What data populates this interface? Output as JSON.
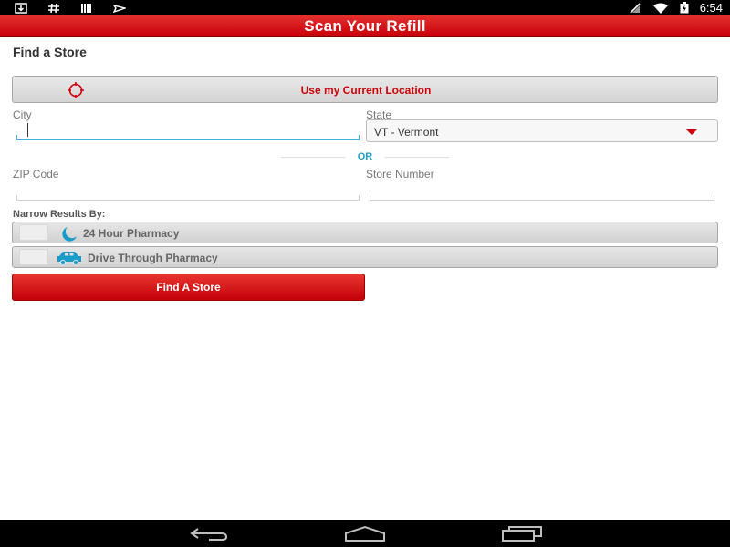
{
  "status_bar": {
    "left_icons": [
      "download-icon",
      "hash-icon",
      "bars-icon",
      "plane-icon"
    ],
    "right_icons": [
      "no-signal-icon",
      "wifi-icon",
      "battery-icon"
    ],
    "time": "6:54"
  },
  "app": {
    "title": "Scan Your Refill",
    "brand_color": "#d0000a"
  },
  "form": {
    "section_title": "Find a Store",
    "use_location_label": "Use my Current Location",
    "city_label": "City",
    "city_value": "",
    "state_label": "State",
    "state_value": "VT - Vermont",
    "or_label": "OR",
    "zip_label": "ZIP Code",
    "zip_value": "",
    "store_number_label": "Store Number",
    "store_number_value": "",
    "narrow_label": "Narrow Results By:",
    "filters": [
      {
        "label": "24 Hour Pharmacy",
        "icon": "moon-icon",
        "checked": false
      },
      {
        "label": "Drive Through Pharmacy",
        "icon": "car-icon",
        "checked": false
      }
    ],
    "find_button_label": "Find A Store"
  },
  "nav_bar": {
    "icons": [
      "back-icon",
      "home-icon",
      "recent-apps-icon"
    ]
  }
}
